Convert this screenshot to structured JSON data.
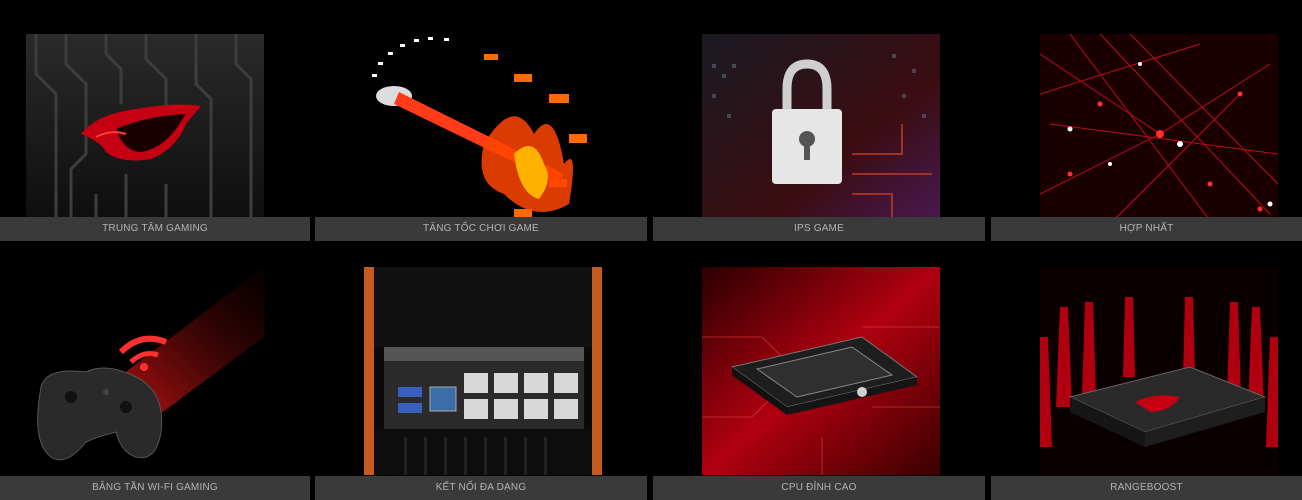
{
  "features": [
    {
      "caption": "TRUNG TÂM GAMING",
      "icon": "rog-logo-icon"
    },
    {
      "caption": "TĂNG TỐC CHƠI GAME",
      "icon": "speedometer-fire-icon"
    },
    {
      "caption": "IPS GAME",
      "icon": "padlock-icon"
    },
    {
      "caption": "HỢP NHẤT",
      "icon": "network-mesh-icon"
    },
    {
      "caption": "BĂNG TẦN WI-FI GAMING",
      "icon": "gamepad-wifi-icon"
    },
    {
      "caption": "KẾT NỐI ĐA DẠNG",
      "icon": "router-ports-icon"
    },
    {
      "caption": "CPU ĐỈNH CAO",
      "icon": "cpu-chip-icon"
    },
    {
      "caption": "RANGEBOOST",
      "icon": "router-antennas-icon"
    }
  ],
  "colors": {
    "accent": "#e5001a",
    "caption_bg": "#3a3a3a",
    "caption_text": "#b3b3b3",
    "background": "#000000"
  }
}
